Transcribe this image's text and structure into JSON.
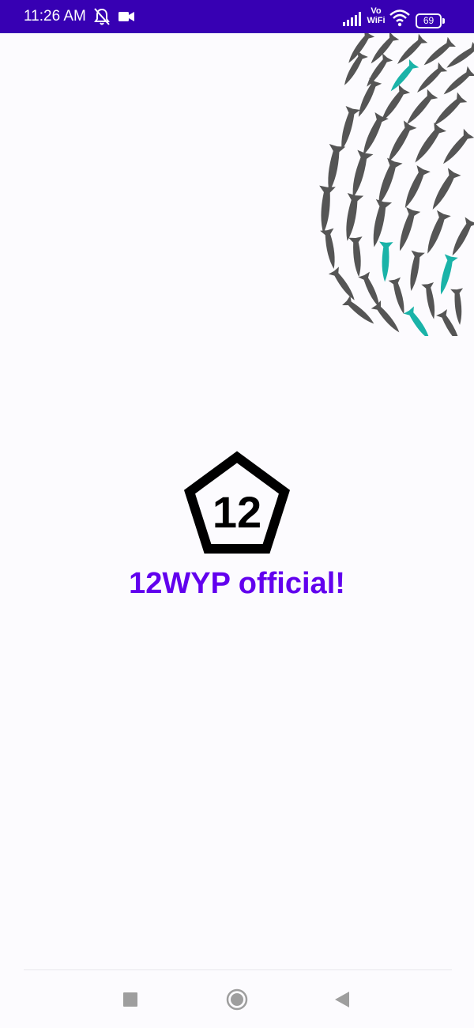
{
  "status_bar": {
    "time": "11:26 AM",
    "vowifi_top": "Vo",
    "vowifi_bottom": "WiFi",
    "battery_level": "69",
    "background": "#3700b3",
    "icons": [
      "mute-notifications-icon",
      "video-camera-icon",
      "signal-icon",
      "wifi-icon",
      "battery-icon"
    ]
  },
  "splash": {
    "logo_text": "12",
    "title": "12WYP official!",
    "title_color": "#6200ee",
    "accent_fish_color": "#1ab3a8",
    "fish_color": "#555555"
  },
  "nav_bar": {
    "buttons": [
      "recent-apps-button",
      "home-button",
      "back-button"
    ]
  }
}
